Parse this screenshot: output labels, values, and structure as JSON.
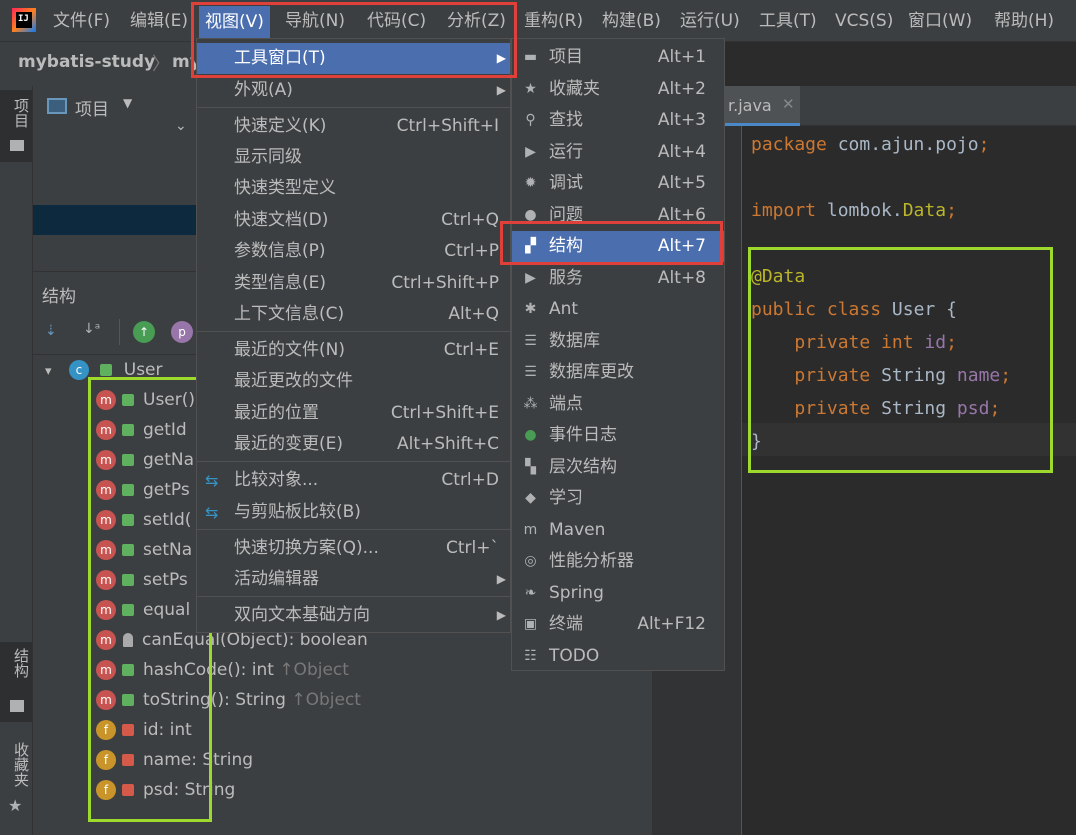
{
  "menubar": {
    "logo_text": "IJ",
    "items": [
      "文件(F)",
      "编辑(E)",
      "视图(V)",
      "导航(N)",
      "代码(C)",
      "分析(Z)",
      "重构(R)",
      "构建(B)",
      "运行(U)",
      "工具(T)",
      "VCS(S)",
      "窗口(W)",
      "帮助(H)"
    ]
  },
  "navbar": {
    "project": "mybatis-study",
    "next": "my"
  },
  "left_strip": {
    "top_tab": "项目",
    "bottom_tab_1": "结构",
    "bottom_tab_2": "收藏夹"
  },
  "project_panel": {
    "title": "项目"
  },
  "structure_panel": {
    "title": "结构",
    "class_name": "User",
    "members": [
      {
        "badge": "m",
        "text": "User()",
        "hint": "",
        "lock": "green"
      },
      {
        "badge": "m",
        "text": "getId",
        "hint": "",
        "lock": "green"
      },
      {
        "badge": "m",
        "text": "getNa",
        "hint": "",
        "lock": "green"
      },
      {
        "badge": "m",
        "text": "getPs",
        "hint": "",
        "lock": "green"
      },
      {
        "badge": "m",
        "text": "setId(",
        "hint": "",
        "lock": "green"
      },
      {
        "badge": "m",
        "text": "setNa",
        "hint": "",
        "lock": "green"
      },
      {
        "badge": "m",
        "text": "setPs",
        "hint": "",
        "lock": "green"
      },
      {
        "badge": "m",
        "text": "equal",
        "hint": "",
        "lock": "green"
      },
      {
        "badge": "m",
        "text": "canEqual(Object): boolean",
        "hint": "",
        "lock": "key"
      },
      {
        "badge": "m",
        "text": "hashCode(): int ",
        "hint": "↑Object",
        "lock": "green"
      },
      {
        "badge": "m",
        "text": "toString(): String ",
        "hint": "↑Object",
        "lock": "green"
      },
      {
        "badge": "f",
        "text": "id: int",
        "hint": "",
        "lock": "red"
      },
      {
        "badge": "f",
        "text": "name: String",
        "hint": "",
        "lock": "red"
      },
      {
        "badge": "f",
        "text": "psd: String",
        "hint": "",
        "lock": "red"
      }
    ]
  },
  "editor": {
    "tab_label": "r.java",
    "lines": [
      {
        "parts": [
          [
            "kw",
            "package "
          ],
          [
            "txt",
            "com.ajun.pojo"
          ],
          [
            "kw",
            ";"
          ]
        ]
      },
      {
        "parts": []
      },
      {
        "parts": [
          [
            "kw",
            "import "
          ],
          [
            "txt",
            "lombok."
          ],
          [
            "ann",
            "Data"
          ],
          [
            "kw",
            ";"
          ]
        ]
      },
      {
        "parts": []
      },
      {
        "parts": [
          [
            "ann",
            "@Data"
          ]
        ]
      },
      {
        "parts": [
          [
            "kw",
            "public class "
          ],
          [
            "txt",
            "User {"
          ]
        ]
      },
      {
        "parts": [
          [
            "txt",
            "    "
          ],
          [
            "kw",
            "private int "
          ],
          [
            "fld",
            "id"
          ],
          [
            "kw",
            ";"
          ]
        ]
      },
      {
        "parts": [
          [
            "txt",
            "    "
          ],
          [
            "kw",
            "private "
          ],
          [
            "txt",
            "String "
          ],
          [
            "fld",
            "name"
          ],
          [
            "kw",
            ";"
          ]
        ]
      },
      {
        "parts": [
          [
            "txt",
            "    "
          ],
          [
            "kw",
            "private "
          ],
          [
            "txt",
            "String "
          ],
          [
            "fld",
            "psd"
          ],
          [
            "kw",
            ";"
          ]
        ]
      },
      {
        "parts": [
          [
            "txt",
            "}"
          ]
        ]
      }
    ]
  },
  "view_menu": [
    {
      "label": "工具窗口(T)",
      "shortcut": "",
      "submenu": true,
      "selected": true
    },
    {
      "label": "外观(A)",
      "shortcut": "",
      "submenu": true
    },
    {
      "label": "快速定义(K)",
      "shortcut": "Ctrl+Shift+I"
    },
    {
      "label": "显示同级",
      "shortcut": ""
    },
    {
      "label": "快速类型定义",
      "shortcut": ""
    },
    {
      "label": "快速文档(D)",
      "shortcut": "Ctrl+Q"
    },
    {
      "label": "参数信息(P)",
      "shortcut": "Ctrl+P"
    },
    {
      "label": "类型信息(E)",
      "shortcut": "Ctrl+Shift+P"
    },
    {
      "label": "上下文信息(C)",
      "shortcut": "Alt+Q"
    },
    {
      "label": "最近的文件(N)",
      "shortcut": "Ctrl+E"
    },
    {
      "label": "最近更改的文件",
      "shortcut": ""
    },
    {
      "label": "最近的位置",
      "shortcut": "Ctrl+Shift+E"
    },
    {
      "label": "最近的变更(E)",
      "shortcut": "Alt+Shift+C"
    },
    {
      "label": "比较对象...",
      "shortcut": "Ctrl+D"
    },
    {
      "label": "与剪贴板比较(B)",
      "shortcut": ""
    },
    {
      "label": "快速切换方案(Q)...",
      "shortcut": "Ctrl+`"
    },
    {
      "label": "活动编辑器",
      "shortcut": "",
      "submenu": true
    },
    {
      "label": "双向文本基础方向",
      "shortcut": "",
      "submenu": true
    }
  ],
  "tool_windows_menu": [
    {
      "icon": "folder-icon",
      "glyph": "▬",
      "label": "项目",
      "shortcut": "Alt+1"
    },
    {
      "icon": "star-icon",
      "glyph": "★",
      "label": "收藏夹",
      "shortcut": "Alt+2"
    },
    {
      "icon": "search-icon",
      "glyph": "⚲",
      "label": "查找",
      "shortcut": "Alt+3"
    },
    {
      "icon": "run-icon",
      "glyph": "▶",
      "label": "运行",
      "shortcut": "Alt+4"
    },
    {
      "icon": "bug-icon",
      "glyph": "✹",
      "label": "调试",
      "shortcut": "Alt+5"
    },
    {
      "icon": "problems-icon",
      "glyph": "●",
      "label": "问题",
      "shortcut": "Alt+6"
    },
    {
      "icon": "structure-icon",
      "glyph": "▞",
      "label": "结构",
      "shortcut": "Alt+7",
      "selected": true
    },
    {
      "icon": "services-icon",
      "glyph": "▶",
      "label": "服务",
      "shortcut": "Alt+8"
    },
    {
      "icon": "ant-icon",
      "glyph": "✱",
      "label": "Ant",
      "shortcut": ""
    },
    {
      "icon": "database-icon",
      "glyph": "☰",
      "label": "数据库",
      "shortcut": ""
    },
    {
      "icon": "database-changes-icon",
      "glyph": "☰",
      "label": "数据库更改",
      "shortcut": ""
    },
    {
      "icon": "endpoints-icon",
      "glyph": "⁂",
      "label": "端点",
      "shortcut": ""
    },
    {
      "icon": "event-log-icon",
      "glyph": "●",
      "label": "事件日志",
      "shortcut": ""
    },
    {
      "icon": "hierarchy-icon",
      "glyph": "▚",
      "label": "层次结构",
      "shortcut": ""
    },
    {
      "icon": "learn-icon",
      "glyph": "◆",
      "label": "学习",
      "shortcut": ""
    },
    {
      "icon": "maven-icon",
      "glyph": "m",
      "label": "Maven",
      "shortcut": ""
    },
    {
      "icon": "profiler-icon",
      "glyph": "◎",
      "label": "性能分析器",
      "shortcut": ""
    },
    {
      "icon": "spring-icon",
      "glyph": "❧",
      "label": "Spring",
      "shortcut": ""
    },
    {
      "icon": "terminal-icon",
      "glyph": "▣",
      "label": "终端",
      "shortcut": "Alt+F12"
    },
    {
      "icon": "todo-icon",
      "glyph": "☷",
      "label": "TODO",
      "shortcut": ""
    }
  ],
  "colors": {
    "accent": "#4b6eaf",
    "highlight_red": "#e0403a",
    "highlight_green": "#9ed92e"
  }
}
